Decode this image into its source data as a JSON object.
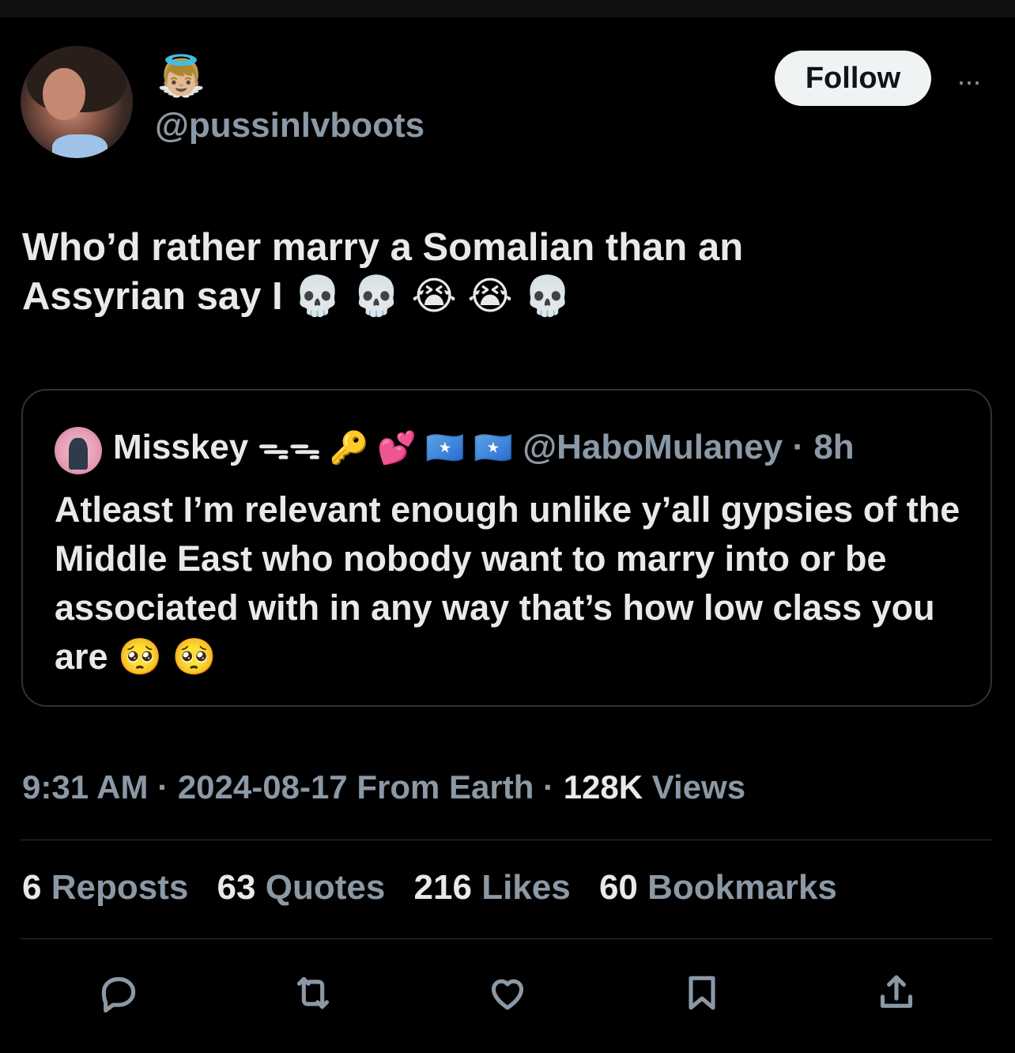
{
  "author": {
    "badge_emoji": "👼🏼",
    "handle": "@pussinlvboots"
  },
  "follow_label": "Follow",
  "more_label": "···",
  "tweet": {
    "text_line1": "Who’d rather marry a Somalian than an",
    "text_line2": "Assyrian say I 💀 💀 😭 😭 💀"
  },
  "quote": {
    "name": "Misskey",
    "emojis": "ᯓᯓ 🔑 💕 🇸🇴 🇸🇴",
    "handle": "@HaboMulaney",
    "separator": " · ",
    "time": "8h",
    "text": "Atleast I’m relevant enough unlike y’all gypsies of the Middle East who nobody want to marry into or be associated with in any way that’s how low class you are 🥺 🥺"
  },
  "meta": {
    "time": "9:31 AM",
    "sep1": " · ",
    "date": "2024-08-17",
    "source": " From Earth",
    "sep2": " · ",
    "views_count": "128K",
    "views_label": " Views"
  },
  "stats": [
    {
      "num": "6",
      "label": "Reposts"
    },
    {
      "num": "63",
      "label": "Quotes"
    },
    {
      "num": "216",
      "label": "Likes"
    },
    {
      "num": "60",
      "label": "Bookmarks"
    }
  ],
  "actions": [
    "reply-icon",
    "repost-icon",
    "like-icon",
    "bookmark-icon",
    "share-icon"
  ]
}
